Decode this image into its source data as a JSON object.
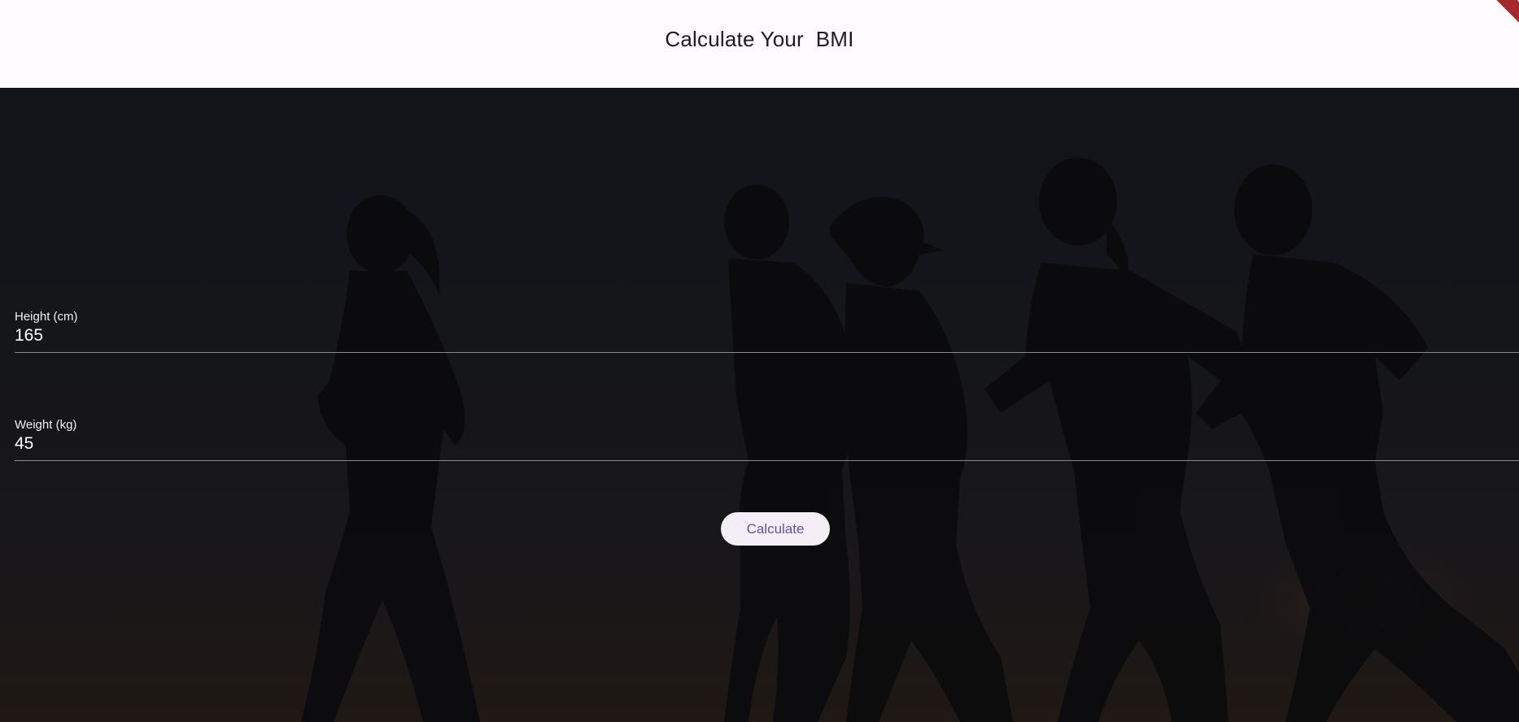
{
  "appbar": {
    "title": "Calculate Your  BMI"
  },
  "form": {
    "height": {
      "label": "Height (cm)",
      "value": "165"
    },
    "weight": {
      "label": "Weight (kg)",
      "value": "45"
    },
    "calculate_label": "Calculate"
  },
  "colors": {
    "appbar_bg": "#fffbfe",
    "button_bg": "#f4eff7",
    "button_text": "#6750a4",
    "debug_banner": "#a4282c"
  },
  "background": {
    "description_icon": "runners-silhouette-image"
  }
}
